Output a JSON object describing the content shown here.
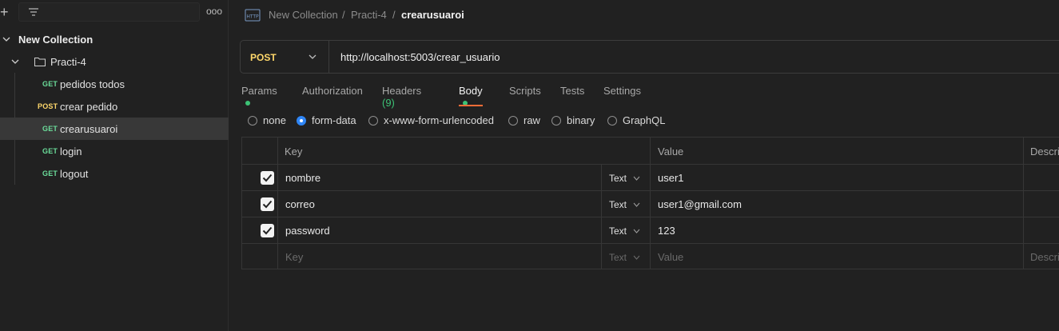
{
  "sidebar": {
    "more_label": "ooo",
    "collection_name": "New Collection",
    "folder_name": "Practi-4",
    "requests": [
      {
        "method": "GET",
        "name": "pedidos todos"
      },
      {
        "method": "POST",
        "name": "crear pedido"
      },
      {
        "method": "GET",
        "name": "crearusuaroi"
      },
      {
        "method": "GET",
        "name": "login"
      },
      {
        "method": "GET",
        "name": "logout"
      }
    ]
  },
  "breadcrumb": {
    "collection": "New Collection",
    "folder": "Practi-4",
    "request": "crearusuaroi",
    "separator": "/"
  },
  "request": {
    "method": "POST",
    "url": "http://localhost:5003/crear_usuario"
  },
  "tabs": [
    {
      "label": "Params",
      "dot": true
    },
    {
      "label": "Authorization"
    },
    {
      "label": "Headers",
      "count": "(9)"
    },
    {
      "label": "Body",
      "dot": true,
      "active": true
    },
    {
      "label": "Scripts"
    },
    {
      "label": "Tests"
    },
    {
      "label": "Settings"
    }
  ],
  "body_types": [
    {
      "label": "none",
      "selected": false
    },
    {
      "label": "form-data",
      "selected": true
    },
    {
      "label": "x-www-form-urlencoded",
      "selected": false
    },
    {
      "label": "raw",
      "selected": false
    },
    {
      "label": "binary",
      "selected": false
    },
    {
      "label": "GraphQL",
      "selected": false
    }
  ],
  "form_table": {
    "headers": {
      "key": "Key",
      "value": "Value",
      "description": "Descri"
    },
    "rows": [
      {
        "checked": true,
        "key": "nombre",
        "type": "Text",
        "value": "user1"
      },
      {
        "checked": true,
        "key": "correo",
        "type": "Text",
        "value": "user1@gmail.com"
      },
      {
        "checked": true,
        "key": "password",
        "type": "Text",
        "value": "123"
      }
    ],
    "placeholder": {
      "key": "Key",
      "type": "Text",
      "value": "Value",
      "description": "Descri"
    }
  },
  "colors": {
    "get": "#6bdd9a",
    "post": "#ffd86b",
    "accent": "#ff6c37",
    "selected_radio": "#2f86f6",
    "indicator": "#3cc275"
  }
}
